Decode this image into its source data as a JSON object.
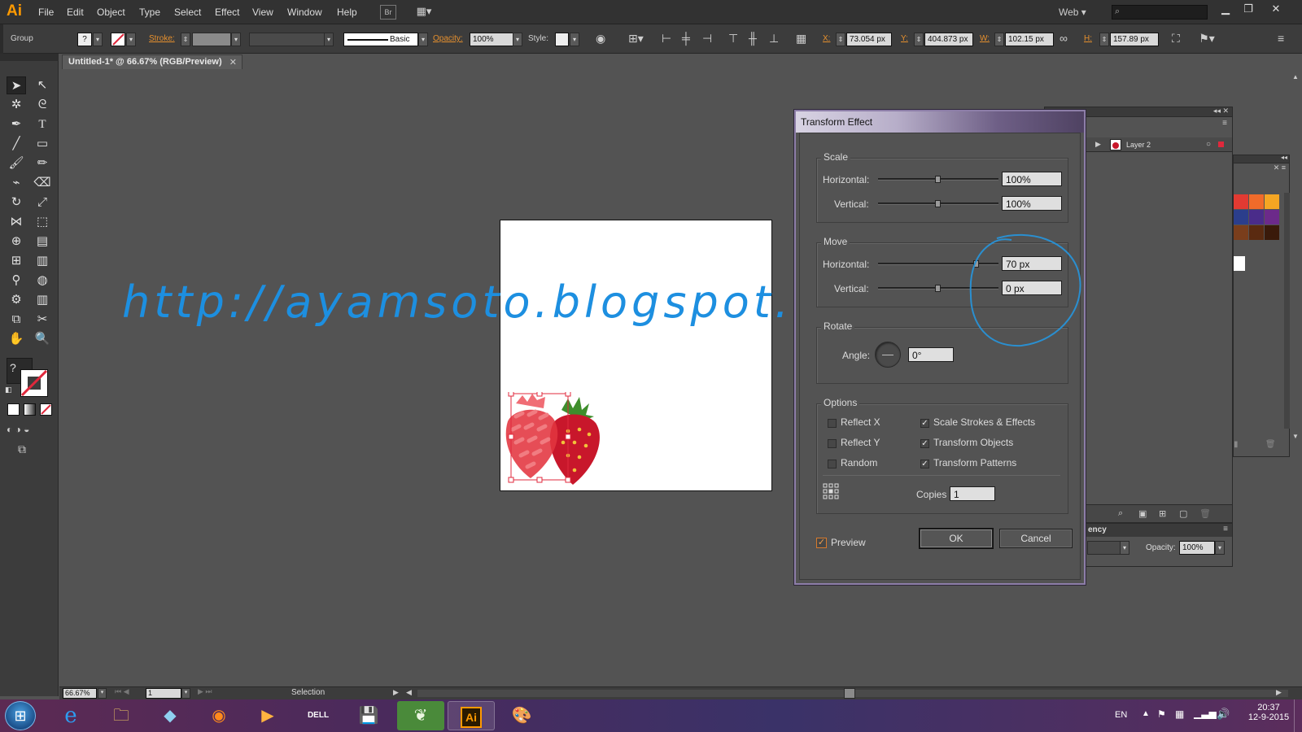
{
  "app": {
    "logo": "Ai",
    "menu": [
      "File",
      "Edit",
      "Object",
      "Type",
      "Select",
      "Effect",
      "View",
      "Window",
      "Help"
    ],
    "bridge_label": "Br",
    "workspace": "Web"
  },
  "control_bar": {
    "selection_type": "Group",
    "stroke_label": "Stroke:",
    "brush_label": "Basic",
    "opacity_label": "Opacity:",
    "opacity_value": "100%",
    "style_label": "Style:",
    "x_label": "X:",
    "x_value": "73.054 px",
    "y_label": "Y:",
    "y_value": "404.873 px",
    "w_label": "W:",
    "w_value": "102.15 px",
    "h_label": "H:",
    "h_value": "157.89 px"
  },
  "document": {
    "tab_title": "Untitled-1* @ 66.67% (RGB/Preview)"
  },
  "watermark": "http://ayamsoto.blogspot.com",
  "layers_panel": {
    "layer_name": "Layer 2"
  },
  "transparency_panel": {
    "title": "ency",
    "opacity_label": "Opacity:",
    "opacity_value": "100%"
  },
  "dialog": {
    "title": "Transform Effect",
    "scale": {
      "title": "Scale",
      "horizontal_label": "Horizontal:",
      "horizontal_value": "100%",
      "vertical_label": "Vertical:",
      "vertical_value": "100%"
    },
    "move": {
      "title": "Move",
      "horizontal_label": "Horizontal:",
      "horizontal_value": "70 px",
      "vertical_label": "Vertical:",
      "vertical_value": "0 px"
    },
    "rotate": {
      "title": "Rotate",
      "angle_label": "Angle:",
      "angle_value": "0°"
    },
    "options": {
      "title": "Options",
      "reflect_x": "Reflect X",
      "reflect_y": "Reflect Y",
      "random": "Random",
      "scale_strokes": "Scale Strokes & Effects",
      "transform_objects": "Transform Objects",
      "transform_patterns": "Transform Patterns",
      "copies_label": "Copies",
      "copies_value": "1"
    },
    "preview_label": "Preview",
    "ok_label": "OK",
    "cancel_label": "Cancel"
  },
  "status_bar": {
    "zoom": "66.67%",
    "artboard": "1",
    "tool": "Selection"
  },
  "taskbar": {
    "language": "EN",
    "time": "20:37",
    "date": "12-9-2015"
  },
  "colors": {
    "accent_orange": "#ff9a00",
    "watermark_blue": "#1d8fe0",
    "annotation_circle": "#2a8fd0",
    "selection_red": "#e0283c"
  }
}
